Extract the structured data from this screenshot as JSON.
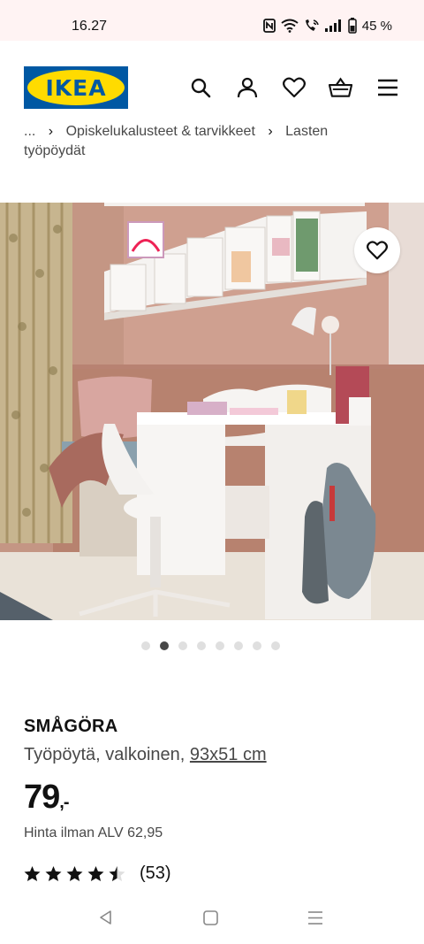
{
  "status_bar": {
    "time": "16.27",
    "battery": "45 %",
    "icons": [
      "nfc-icon",
      "wifi-icon",
      "wifi-calling-icon",
      "signal-icon",
      "battery-icon"
    ]
  },
  "header": {
    "logo_text": "IKEA",
    "icons": [
      "search-icon",
      "account-icon",
      "heart-icon",
      "basket-icon",
      "menu-icon"
    ],
    "colors": {
      "brand_blue": "#0058a3",
      "brand_yellow": "#ffdb00"
    }
  },
  "breadcrumb": {
    "ellipsis": "...",
    "items": [
      "Opiskelukalusteet & tarvikkeet",
      "Lasten"
    ],
    "continuation": "työpöydät"
  },
  "gallery": {
    "image_count": 8,
    "active_index": 1,
    "image_alt": "SMÅGÖRA desk in a children's room"
  },
  "product": {
    "name": "SMÅGÖRA",
    "description": "Työpöytä, valkoinen,",
    "size": "93x51 cm",
    "price": "79",
    "price_suffix": ",-",
    "vat_note": "Hinta ilman ALV 62,95",
    "rating_value": 4.5,
    "rating_max": 5,
    "review_count": "(53)"
  },
  "system_nav": {
    "icons": [
      "back-icon",
      "home-icon",
      "recents-icon"
    ]
  }
}
